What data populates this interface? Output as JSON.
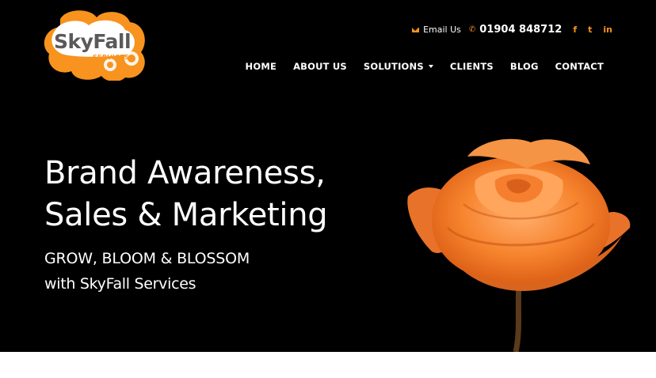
{
  "brand": {
    "name": "SkyFall",
    "tagline": "SERVICES",
    "logo_color": "#f7931e",
    "logo_text_color": "#5a5a5a"
  },
  "topbar": {
    "email_label": "Email Us",
    "phone": "01904 848712",
    "social": [
      "f",
      "t",
      "in"
    ]
  },
  "nav": {
    "items": [
      {
        "label": "HOME"
      },
      {
        "label": "ABOUT US"
      },
      {
        "label": "SOLUTIONS",
        "dropdown": true
      },
      {
        "label": "CLIENTS"
      },
      {
        "label": "BLOG"
      },
      {
        "label": "CONTACT"
      }
    ]
  },
  "hero": {
    "headline_line1": "Brand Awareness,",
    "headline_line2": "Sales & Marketing",
    "sub_line1": "GROW, BLOOM & BLOSSOM",
    "sub_line2": "with SkyFall Services",
    "background": "#000000",
    "accent": "#f7931e"
  }
}
